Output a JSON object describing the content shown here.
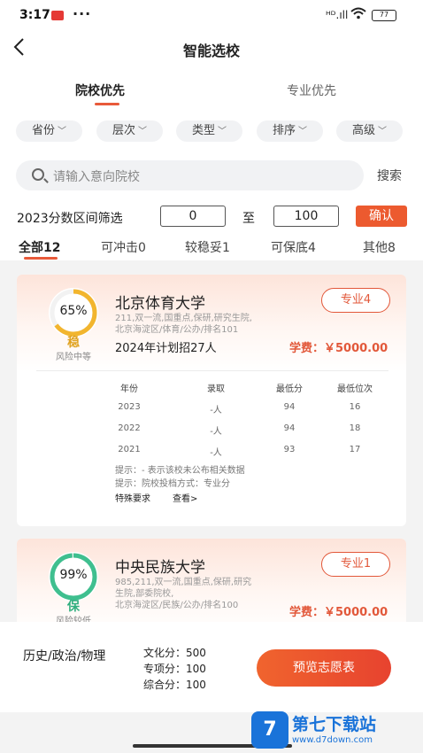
{
  "status_bar": {
    "time": "3:17",
    "more": "···",
    "signal": "ᴴᴰ.ıll",
    "battery": "77"
  },
  "nav": {
    "back_icon": "chevron-left-icon",
    "title": "智能选校"
  },
  "mode_tabs": [
    {
      "label": "院校优先",
      "active": true
    },
    {
      "label": "专业优先",
      "active": false
    }
  ],
  "filters": [
    {
      "label": "省份"
    },
    {
      "label": "层次"
    },
    {
      "label": "类型"
    },
    {
      "label": "排序"
    },
    {
      "label": "高级"
    }
  ],
  "search": {
    "placeholder": "请输入意向院校",
    "button": "搜索"
  },
  "score_range": {
    "label": "2023分数区间筛选",
    "min": "0",
    "to": "至",
    "max": "100",
    "confirm": "确认"
  },
  "result_tabs": [
    {
      "label": "全部12",
      "active": true
    },
    {
      "label": "可冲击0",
      "active": false
    },
    {
      "label": "较稳妥1",
      "active": false
    },
    {
      "label": "可保底4",
      "active": false
    },
    {
      "label": "其他8",
      "active": false
    }
  ],
  "schools": [
    {
      "probability_text": "65%",
      "probability": 0.65,
      "ring_color": "#f2b52e",
      "tag": "稳",
      "tag_color": "#e0a321",
      "risk": "风险中等",
      "name": "北京体育大学",
      "meta_line1": "211,双一流,国重点,保研,研究生院,",
      "meta_line2": "北京海淀区/体育/公办/排名101",
      "plan": "2024年计划招27人",
      "major_button": "专业4",
      "fee": "学费：￥5000.00",
      "table_headers": [
        "年份",
        "录取",
        "最低分",
        "最低位次"
      ],
      "rows": [
        [
          "2023",
          "-人",
          "94",
          "16"
        ],
        [
          "2022",
          "-人",
          "94",
          "18"
        ],
        [
          "2021",
          "-人",
          "93",
          "17"
        ]
      ],
      "note1": "提示：- 表示该校未公布相关数据",
      "note2": "提示：院校投档方式：专业分",
      "special": "特殊要求",
      "view": "查看>"
    },
    {
      "probability_text": "99%",
      "probability": 0.99,
      "ring_color": "#3fbf8f",
      "tag": "保",
      "tag_color": "#2fae7e",
      "risk": "风险较低",
      "name": "中央民族大学",
      "meta_line1": "985,211,双一流,国重点,保研,研究",
      "meta_line2": "生院,部委院校,",
      "meta_line3": "北京海淀区/民族/公办/排名100",
      "major_button": "专业1",
      "fee": "学费：￥5000.00"
    }
  ],
  "bottom": {
    "subjects": "历史/政治/物理",
    "culture_score": "文化分：500",
    "special_score": "专项分：100",
    "total_score": "综合分：100",
    "preview_button": "预览志愿表"
  },
  "watermark": {
    "logo_char": "7",
    "title": "第七下载站",
    "url": "www.d7down.com"
  }
}
